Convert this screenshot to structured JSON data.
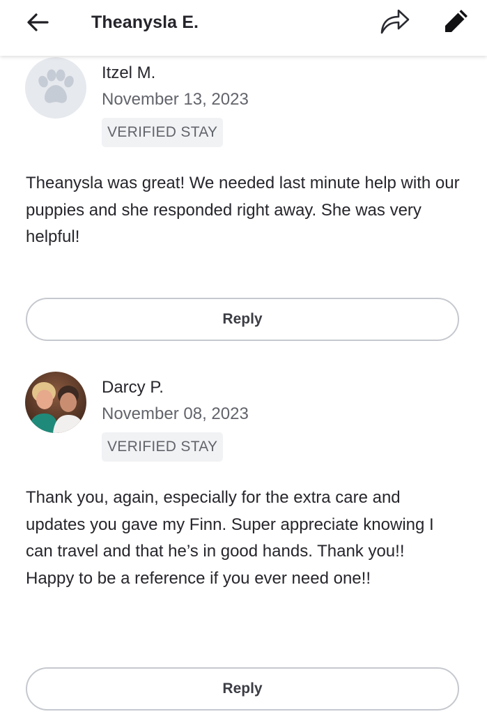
{
  "header": {
    "title": "Theanysla E."
  },
  "reviews": [
    {
      "name": "Itzel M.",
      "date": "November 13, 2023",
      "badge": "VERIFIED STAY",
      "avatar": "default-paw-icon",
      "text": "Theanysla was great! We needed last minute help with our puppies and she responded right away. She was very helpful!",
      "reply_label": "Reply"
    },
    {
      "name": "Darcy P.",
      "date": "November 08, 2023",
      "badge": "VERIFIED STAY",
      "avatar": "profile-photo",
      "text": "Thank you, again, especially for the extra care and updates you gave my Finn. Super appreciate knowing I can travel and that he’s in good hands. Thank you!! Happy to be a reference if you ever need one!!",
      "reply_label": "Reply"
    }
  ],
  "icons": {
    "back": "arrow-left-icon",
    "share": "share-icon",
    "edit": "pencil-icon"
  },
  "colors": {
    "text_primary": "#26262c",
    "text_secondary": "#62646b",
    "badge_bg": "#f1f2f4",
    "button_border": "#c5c8ce"
  }
}
